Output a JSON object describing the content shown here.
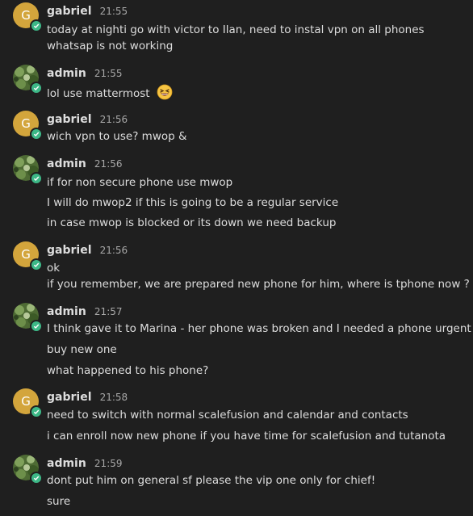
{
  "colors": {
    "background": "#1f1f1f",
    "text": "#dddddd",
    "timestamp": "#a8a8a8",
    "online_status": "#3db887",
    "gabriel_avatar": "#d3a53c",
    "admin_avatar_green": "#5b7f3a"
  },
  "posts": [
    {
      "user": "gabriel",
      "avatar_letter": "G",
      "time": "21:55",
      "lines": [
        "today at nighti go with victor to Ilan, need to instal vpn on all phones",
        "whatsap is not working"
      ]
    },
    {
      "user": "admin",
      "time": "21:55",
      "lines": [
        "lol use mattermost"
      ],
      "emoji": "laughing-emoji"
    },
    {
      "user": "gabriel",
      "avatar_letter": "G",
      "time": "21:56",
      "lines": [
        "wich vpn to use? mwop &"
      ]
    },
    {
      "user": "admin",
      "time": "21:56",
      "lines": [
        "if for non secure phone use mwop",
        "I will do mwop2 if this is going to be a regular service",
        "in case mwop is blocked or its down we need backup"
      ]
    },
    {
      "user": "gabriel",
      "avatar_letter": "G",
      "time": "21:56",
      "lines": [
        "ok",
        "if you remember, we are prepared new phone for him, where is tphone now ?"
      ]
    },
    {
      "user": "admin",
      "time": "21:57",
      "lines": [
        "I think gave it to Marina - her phone was broken and I needed a phone urgent",
        "buy new one",
        "what happened to his phone?"
      ]
    },
    {
      "user": "gabriel",
      "avatar_letter": "G",
      "time": "21:58",
      "lines": [
        "need to switch with normal scalefusion and calendar and contacts",
        "i can enroll now new phone if you have time for scalefusion and tutanota"
      ]
    },
    {
      "user": "admin",
      "time": "21:59",
      "lines": [
        "dont put him on general sf please the vip one only for chief!",
        "sure"
      ]
    }
  ]
}
